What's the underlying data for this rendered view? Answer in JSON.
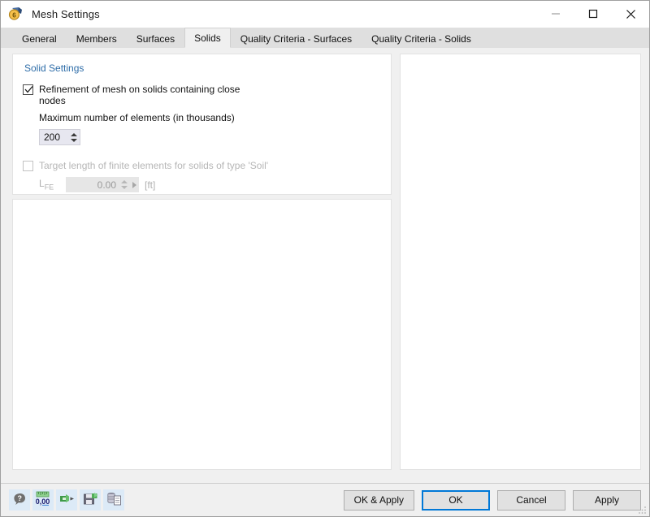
{
  "window": {
    "title": "Mesh Settings",
    "icon": "mesh-settings-icon",
    "minimize_label": "—",
    "maximize_label": "☐",
    "close_label": "✕"
  },
  "tabs": [
    {
      "label": "General",
      "active": false
    },
    {
      "label": "Members",
      "active": false
    },
    {
      "label": "Surfaces",
      "active": false
    },
    {
      "label": "Solids",
      "active": true
    },
    {
      "label": "Quality Criteria - Surfaces",
      "active": false
    },
    {
      "label": "Quality Criteria - Solids",
      "active": false
    }
  ],
  "solid_settings": {
    "group_title": "Solid Settings",
    "refinement": {
      "label": "Refinement of mesh on solids containing close nodes",
      "checked": true,
      "sub_label": "Maximum number of elements (in thousands)",
      "value": "200"
    },
    "target_length": {
      "label": "Target length of finite elements for solids of type 'Soil'",
      "checked": false,
      "field_label_base": "L",
      "field_label_sub": "FE",
      "value": "0.00",
      "unit": "[ft]"
    }
  },
  "footer": {
    "tools": [
      {
        "name": "help-icon",
        "title": "Help"
      },
      {
        "name": "decimal-places-icon",
        "title": "Number Format",
        "text": "0,00"
      },
      {
        "name": "import-settings-icon",
        "title": "Import"
      },
      {
        "name": "save-settings-icon",
        "title": "Save"
      },
      {
        "name": "copy-to-document-icon",
        "title": "Copy"
      }
    ],
    "buttons": [
      {
        "label": "OK & Apply",
        "default": false
      },
      {
        "label": "OK",
        "default": true
      },
      {
        "label": "Cancel",
        "default": false
      },
      {
        "label": "Apply",
        "default": false
      }
    ]
  },
  "colors": {
    "accent": "#2d6ca8",
    "focus_border": "#0078d7",
    "toolbar_button_bg": "#dceaf7",
    "panel_bg": "#ffffff",
    "window_bg": "#f0f0f0"
  }
}
